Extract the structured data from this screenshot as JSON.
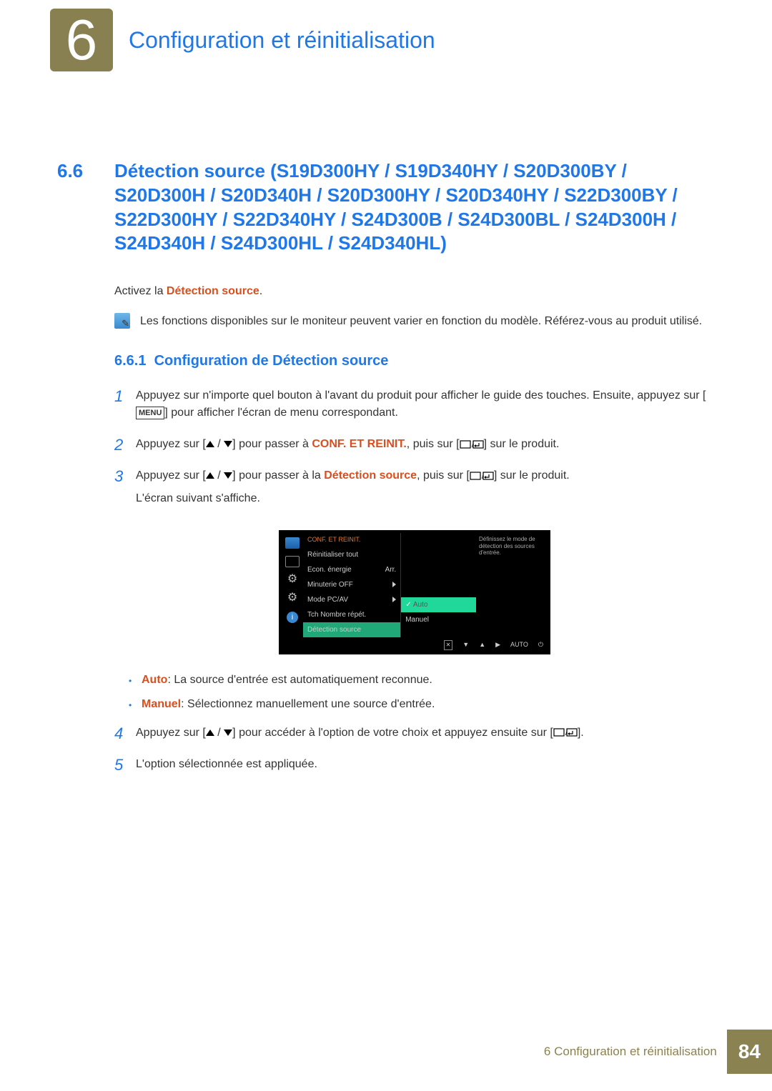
{
  "header": {
    "chapter_number": "6",
    "chapter_title": "Configuration et réinitialisation"
  },
  "section": {
    "number": "6.6",
    "title": "Détection source (S19D300HY / S19D340HY / S20D300BY / S20D300H / S20D340H / S20D300HY / S20D340HY / S22D300BY / S22D300HY / S22D340HY / S24D300B / S24D300BL / S24D300H / S24D340H / S24D300HL / S24D340HL)"
  },
  "intro": {
    "prefix": "Activez la ",
    "term": "Détection source",
    "suffix": "."
  },
  "note": "Les fonctions disponibles sur le moniteur peuvent varier en fonction du modèle. Référez-vous au produit utilisé.",
  "subsection": {
    "number": "6.6.1",
    "title": "Configuration de Détection source"
  },
  "steps": {
    "s1": {
      "num": "1",
      "line1_a": "Appuyez sur n'importe quel bouton à l'avant du produit pour afficher le guide des touches. Ensuite, appuyez sur [",
      "menu": "MENU",
      "line1_b": "] pour afficher l'écran de menu correspondant."
    },
    "s2": {
      "num": "2",
      "a": "Appuyez sur [",
      "b": "] pour passer à ",
      "term": "CONF. ET REINIT.",
      "c": ", puis sur [",
      "d": "] sur le produit."
    },
    "s3": {
      "num": "3",
      "a": "Appuyez sur [",
      "b": "] pour passer à la ",
      "term": "Détection source",
      "c": ", puis sur [",
      "d": "] sur le produit.",
      "line2": "L'écran suivant s'affiche."
    },
    "s4": {
      "num": "4",
      "a": "Appuyez sur [",
      "b": "] pour accéder à l'option de votre choix et appuyez ensuite sur [",
      "c": "]."
    },
    "s5": {
      "num": "5",
      "text": "L'option sélectionnée est appliquée."
    }
  },
  "osd": {
    "header": "CONF. ET REINIT.",
    "items": {
      "reset": "Réinitialiser tout",
      "eco": "Econ. énergie",
      "eco_val": "Arr.",
      "timer": "Minuterie OFF",
      "mode": "Mode PC/AV",
      "repeat": "Tch Nombre répét.",
      "detect": "Détection source"
    },
    "sub": {
      "auto": "Auto",
      "manuel": "Manuel"
    },
    "help": "Définissez le mode de détection des sources d'entrée.",
    "bottom_auto": "AUTO"
  },
  "bullets": {
    "b1_term": "Auto",
    "b1_text": ": La source d'entrée est automatiquement reconnue.",
    "b2_term": "Manuel",
    "b2_text": ": Sélectionnez manuellement une source d'entrée."
  },
  "footer": {
    "text": "6 Configuration et réinitialisation",
    "page": "84"
  }
}
